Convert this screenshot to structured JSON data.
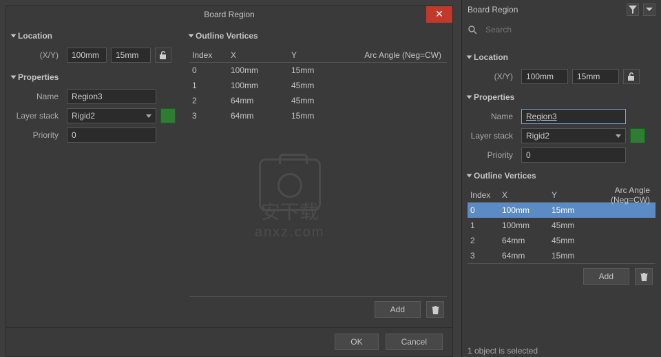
{
  "dialog": {
    "title": "Board Region",
    "ok": "OK",
    "cancel": "Cancel"
  },
  "location": {
    "header": "Location",
    "xy_label": "(X/Y)",
    "x": "100mm",
    "y": "15mm"
  },
  "properties": {
    "header": "Properties",
    "name_label": "Name",
    "name": "Region3",
    "layerstack_label": "Layer stack",
    "layerstack": "Rigid2",
    "priority_label": "Priority",
    "priority": "0"
  },
  "vertices": {
    "header": "Outline Vertices",
    "cols": {
      "index": "Index",
      "x": "X",
      "y": "Y",
      "arc": "Arc Angle (Neg=CW)"
    },
    "rows": [
      {
        "idx": "0",
        "x": "100mm",
        "y": "15mm",
        "arc": ""
      },
      {
        "idx": "1",
        "x": "100mm",
        "y": "45mm",
        "arc": ""
      },
      {
        "idx": "2",
        "x": "64mm",
        "y": "45mm",
        "arc": ""
      },
      {
        "idx": "3",
        "x": "64mm",
        "y": "15mm",
        "arc": ""
      }
    ],
    "add": "Add"
  },
  "panel": {
    "title": "Board Region",
    "search_placeholder": "Search",
    "status": "1 object is selected",
    "location": {
      "header": "Location",
      "xy_label": "(X/Y)",
      "x": "100mm",
      "y": "15mm"
    },
    "properties": {
      "header": "Properties",
      "name_label": "Name",
      "name": "Region3",
      "layerstack_label": "Layer stack",
      "layerstack": "Rigid2",
      "priority_label": "Priority",
      "priority": "0"
    },
    "vertices": {
      "header": "Outline Vertices",
      "cols": {
        "index": "Index",
        "x": "X",
        "y": "Y",
        "arc": "Arc Angle (Neg=CW)"
      },
      "rows": [
        {
          "idx": "0",
          "x": "100mm",
          "y": "15mm",
          "arc": "",
          "selected": true
        },
        {
          "idx": "1",
          "x": "100mm",
          "y": "45mm",
          "arc": ""
        },
        {
          "idx": "2",
          "x": "64mm",
          "y": "45mm",
          "arc": ""
        },
        {
          "idx": "3",
          "x": "64mm",
          "y": "15mm",
          "arc": ""
        }
      ],
      "add": "Add"
    }
  },
  "icons": {
    "lock": "lock-icon",
    "trash": "trash-icon",
    "filter": "filter-icon",
    "search": "search-icon"
  }
}
